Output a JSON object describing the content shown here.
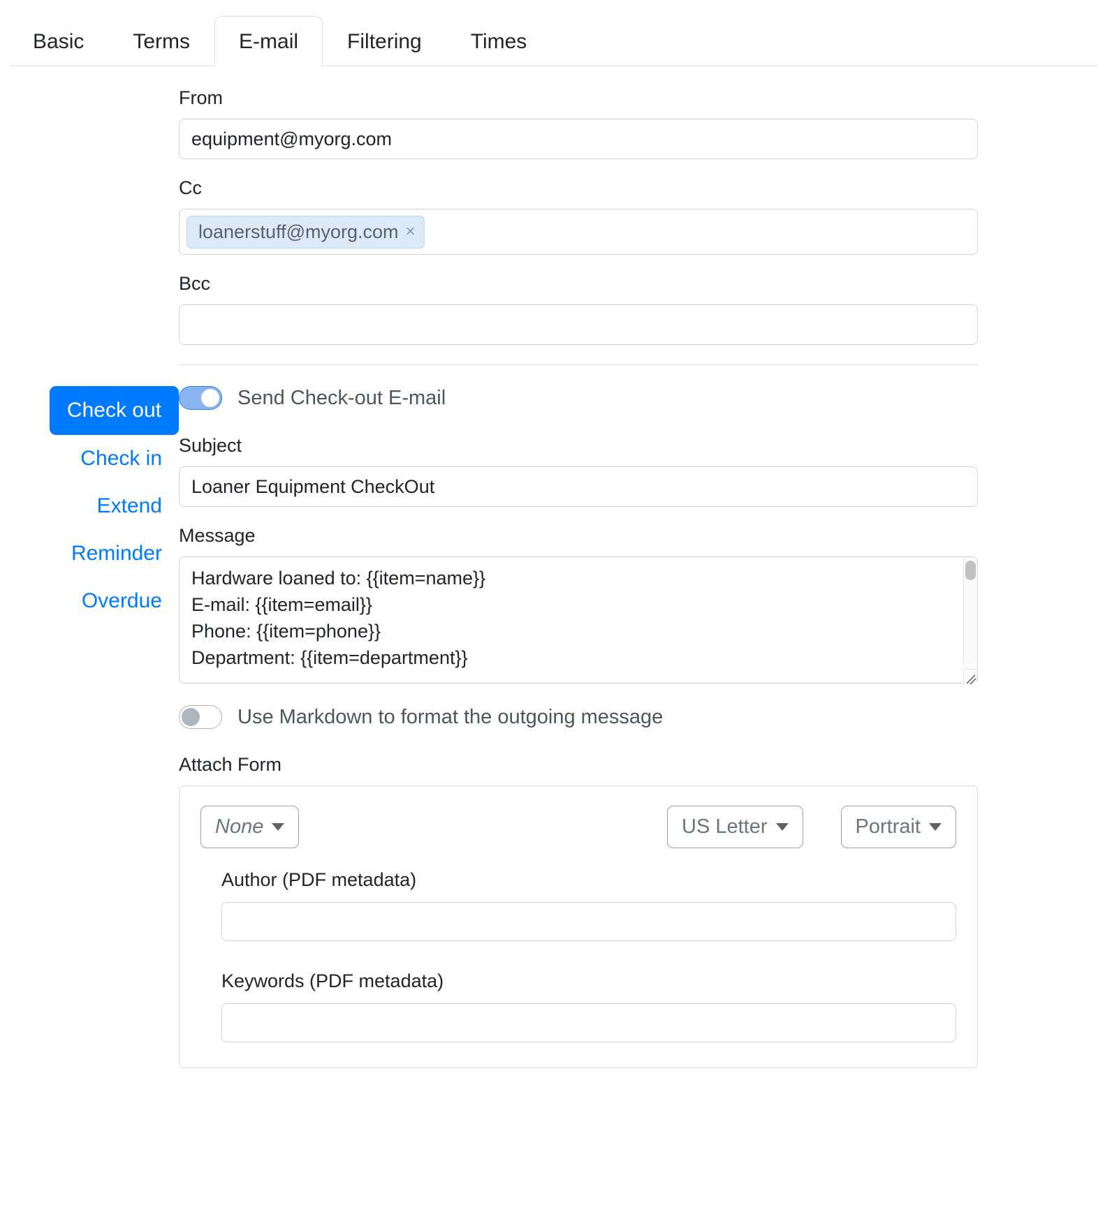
{
  "tabs": [
    {
      "label": "Basic",
      "active": false
    },
    {
      "label": "Terms",
      "active": false
    },
    {
      "label": "E-mail",
      "active": true
    },
    {
      "label": "Filtering",
      "active": false
    },
    {
      "label": "Times",
      "active": false
    }
  ],
  "email_form": {
    "from": {
      "label": "From",
      "value": "equipment@myorg.com",
      "placeholder": ""
    },
    "cc": {
      "label": "Cc",
      "chip": "loanerstuff@myorg.com",
      "chip_remove_icon": "close-icon",
      "placeholder": ""
    },
    "bcc": {
      "label": "Bcc",
      "value": "",
      "placeholder": ""
    }
  },
  "sidebar": {
    "items": [
      {
        "label": "Check out",
        "active": true
      },
      {
        "label": "Check in",
        "active": false
      },
      {
        "label": "Extend",
        "active": false
      },
      {
        "label": "Reminder",
        "active": false
      },
      {
        "label": "Overdue",
        "active": false
      }
    ]
  },
  "panel": {
    "send_toggle": {
      "label": "Send Check-out E-mail",
      "state": "on"
    },
    "subject": {
      "label": "Subject",
      "value": "Loaner Equipment CheckOut",
      "placeholder": ""
    },
    "message": {
      "label": "Message",
      "value": "Hardware loaned to: {{item=name}}\nE-mail: {{item=email}}\nPhone: {{item=phone}}\nDepartment: {{item=department}}"
    },
    "markdown_toggle": {
      "label": "Use Markdown to format the outgoing message",
      "state": "off"
    },
    "attach_form": {
      "label": "Attach Form",
      "form_select": {
        "value": "None"
      },
      "paper_select": {
        "value": "US Letter"
      },
      "orientation_select": {
        "value": "Portrait"
      },
      "author": {
        "label": "Author (PDF metadata)",
        "value": "",
        "placeholder": ""
      },
      "keywords": {
        "label": "Keywords (PDF metadata)",
        "value": "",
        "placeholder": ""
      }
    }
  },
  "colors": {
    "accent": "#007bff",
    "toggle_on_track": "#8ab3f0",
    "toggle_on_border": "#2a7cf7",
    "chip_bg": "#dbe9f9",
    "border": "#ced4da"
  }
}
